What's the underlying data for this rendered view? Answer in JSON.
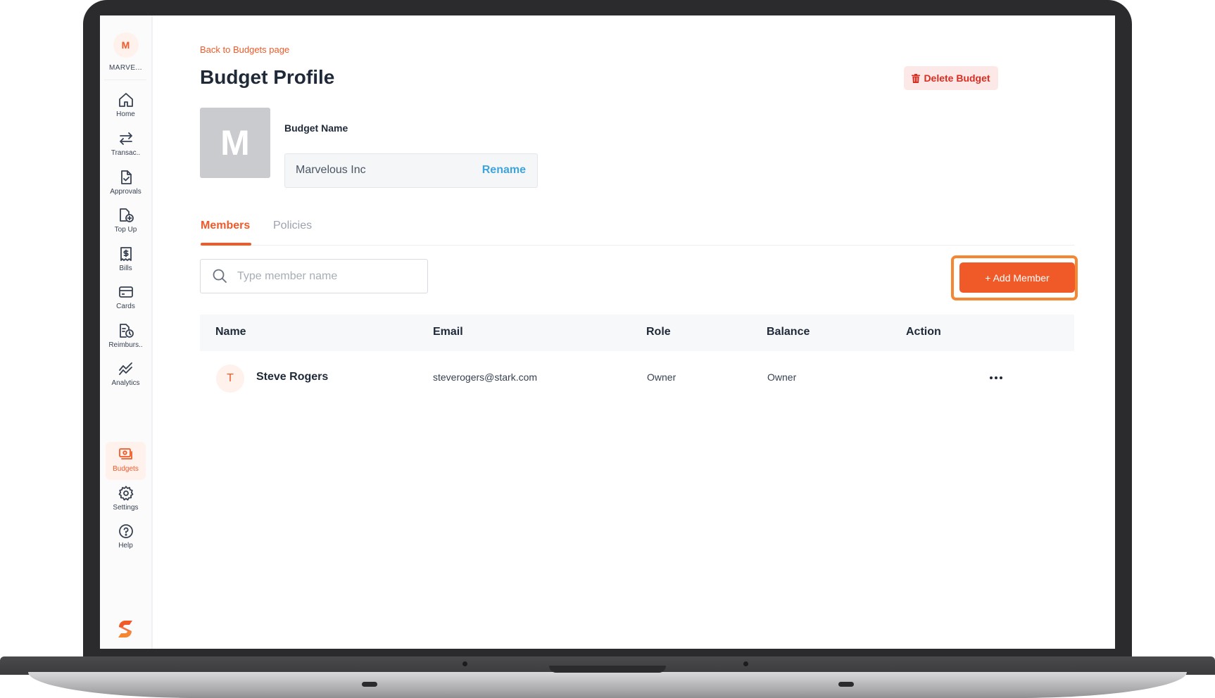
{
  "sidebar": {
    "org": {
      "initial": "M",
      "name": "MARVE..."
    },
    "items": [
      {
        "label": "Home",
        "icon": "home-icon"
      },
      {
        "label": "Transac..",
        "icon": "transfer-arrows-icon"
      },
      {
        "label": "Approvals",
        "icon": "approval-document-icon"
      },
      {
        "label": "Top Up",
        "icon": "top-up-icon"
      },
      {
        "label": "Bills",
        "icon": "bill-receipt-icon"
      },
      {
        "label": "Cards",
        "icon": "card-icon"
      },
      {
        "label": "Reimburs..",
        "icon": "reimbursement-icon"
      },
      {
        "label": "Analytics",
        "icon": "analytics-chart-icon"
      }
    ],
    "bottom_items": [
      {
        "label": "Budgets",
        "icon": "budgets-icon",
        "active": true
      },
      {
        "label": "Settings",
        "icon": "gear-icon"
      },
      {
        "label": "Help",
        "icon": "help-question-icon"
      }
    ]
  },
  "main": {
    "back_link": "Back to Budgets page",
    "title": "Budget Profile",
    "delete_label": "Delete Budget",
    "avatar_initial": "M",
    "budget_name_label": "Budget Name",
    "budget_name_value": "Marvelous Inc",
    "rename_label": "Rename",
    "tabs": [
      {
        "label": "Members",
        "active": true
      },
      {
        "label": "Policies",
        "active": false
      }
    ],
    "search_placeholder": "Type member name",
    "add_member_label": "+ Add Member",
    "table": {
      "headers": [
        "Name",
        "Email",
        "Role",
        "Balance",
        "Action"
      ],
      "rows": [
        {
          "initial": "T",
          "name": "Steve Rogers",
          "email": "steverogers@stark.com",
          "role": "Owner",
          "balance": "Owner"
        }
      ]
    }
  },
  "colors": {
    "accent": "#f05a28",
    "highlight": "#f58733",
    "danger": "#d92d20",
    "link": "#3fa4dc"
  }
}
